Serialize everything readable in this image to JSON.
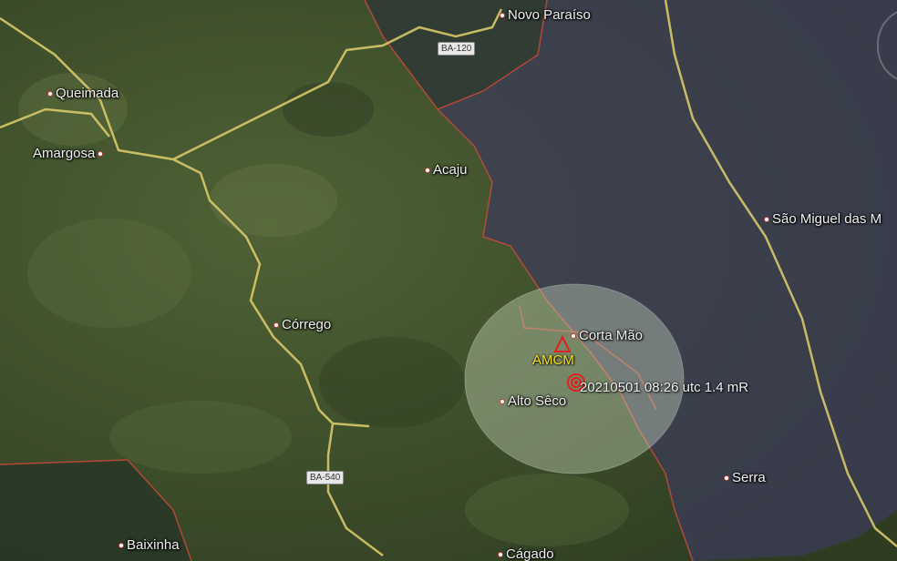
{
  "places": [
    {
      "id": "novo-paraiso",
      "label": "Novo Paraíso"
    },
    {
      "id": "queimada",
      "label": "Queimada"
    },
    {
      "id": "amargosa",
      "label": "Amargosa"
    },
    {
      "id": "acaju",
      "label": "Acaju"
    },
    {
      "id": "sao-miguel",
      "label": "São Miguel das M"
    },
    {
      "id": "corrego",
      "label": "Córrego"
    },
    {
      "id": "corta-mao",
      "label": "Corta Mão"
    },
    {
      "id": "alto-seco",
      "label": "Alto Sêco"
    },
    {
      "id": "serra",
      "label": "Serra"
    },
    {
      "id": "baixinha",
      "label": "Baixinha"
    },
    {
      "id": "cagado",
      "label": "Cágado"
    }
  ],
  "roads": [
    {
      "id": "ba-120",
      "label": "BA-120"
    },
    {
      "id": "ba-540",
      "label": "BA-540"
    }
  ],
  "station": {
    "code": "AMCM",
    "color": "#f7e21c"
  },
  "event": {
    "label": "20210501 08:26 utc 1.4 mR",
    "color": "#e02020"
  },
  "colors": {
    "boundary": "#c94a3a",
    "road": "#d9c96a",
    "shaded_region": "#4a4a66"
  }
}
